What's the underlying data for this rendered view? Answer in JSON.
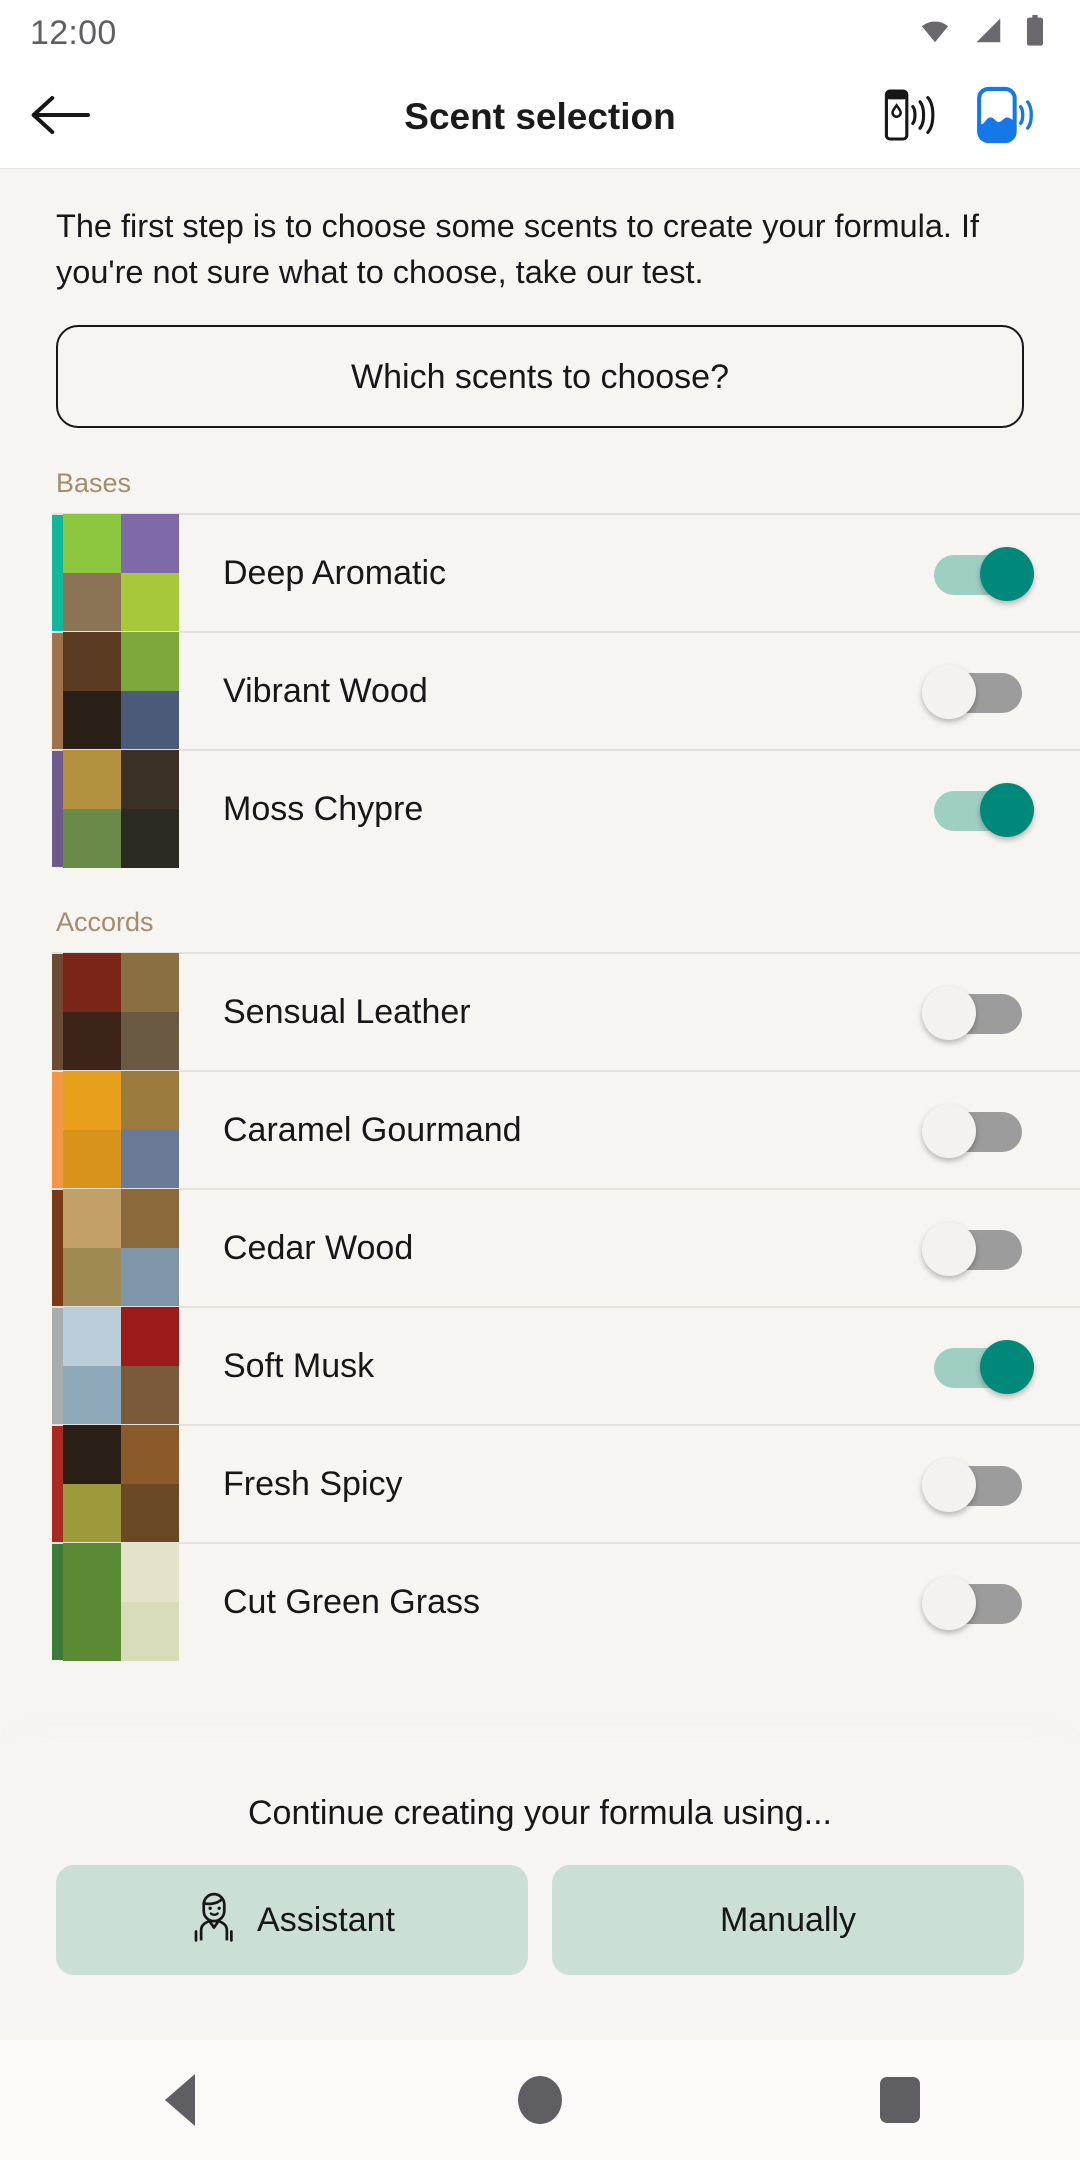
{
  "status_bar": {
    "clock": "12:00",
    "icons": [
      "wifi-icon",
      "cellular-signal-icon",
      "battery-icon"
    ]
  },
  "app_bar": {
    "back_icon": "arrow-left-icon",
    "title": "Scent selection",
    "actions": [
      {
        "name": "dispenser-connect-icon",
        "color": "#17171A"
      },
      {
        "name": "device-connect-icon",
        "color": "#1577E8"
      }
    ]
  },
  "main": {
    "intro_text": "The first step is to choose some scents to create your formula. If you're not sure what to choose, take our test.",
    "cta_label": "Which scents to choose?",
    "sections": [
      {
        "label": "Bases",
        "items": [
          {
            "name": "Deep Aromatic",
            "enabled": true,
            "accent": "#12B79B",
            "tiles": [
              "#8CC63E",
              "#7E6AA8",
              "#8B7355",
              "#A8C83C"
            ]
          },
          {
            "name": "Vibrant Wood",
            "enabled": false,
            "accent": "#A0724A",
            "tiles": [
              "#5A3B22",
              "#7FA83C",
              "#2A2018",
              "#4A5A78"
            ]
          },
          {
            "name": "Moss Chypre",
            "enabled": true,
            "accent": "#6E5A8C",
            "tiles": [
              "#B4913F",
              "#3A3026",
              "#6A8A4A",
              "#2B2B24"
            ]
          }
        ]
      },
      {
        "label": "Accords",
        "items": [
          {
            "name": "Sensual Leather",
            "enabled": false,
            "accent": "#6B4A36",
            "tiles": [
              "#7B2418",
              "#8A7040",
              "#3C2418",
              "#6A5A44"
            ]
          },
          {
            "name": "Caramel Gourmand",
            "enabled": false,
            "accent": "#F2974A",
            "tiles": [
              "#E8A01A",
              "#9C7B3E",
              "#D8941A",
              "#6A7A96"
            ]
          },
          {
            "name": "Cedar Wood",
            "enabled": false,
            "accent": "#7A3A18",
            "tiles": [
              "#C2A068",
              "#8A6A3A",
              "#A08A54",
              "#7E95AA"
            ]
          },
          {
            "name": "Soft Musk",
            "enabled": true,
            "accent": "#A9ADAE",
            "tiles": [
              "#BCCDDA",
              "#9C1A1A",
              "#8FA8BA",
              "#7A5A3A"
            ]
          },
          {
            "name": "Fresh Spicy",
            "enabled": false,
            "accent": "#A82A20",
            "tiles": [
              "#2A2018",
              "#8A5A2A",
              "#9C9A3A",
              "#6A4A24"
            ]
          },
          {
            "name": "Cut Green Grass",
            "enabled": false,
            "accent": "#3C7A3A",
            "tiles": [
              "#5A8A34",
              "#E4E2C8",
              "#5A8A34",
              "#D8DCBA"
            ]
          }
        ]
      }
    ]
  },
  "bottom_sheet": {
    "title": "Continue creating your formula using...",
    "buttons": [
      {
        "label": "Assistant",
        "icon": "assistant-person-icon"
      },
      {
        "label": "Manually",
        "icon": ""
      }
    ]
  },
  "nav_bar": {
    "back": "nav-back-icon",
    "home": "nav-home-icon",
    "recents": "nav-recents-icon"
  },
  "colors": {
    "background": "#F7F5F2",
    "toggle_on_track": "#9FCEC3",
    "toggle_on_thumb": "#00897B",
    "toggle_off_track": "#9C9C9C",
    "section_label": "#A38D6D",
    "sheet_button": "#CBDFD5"
  }
}
